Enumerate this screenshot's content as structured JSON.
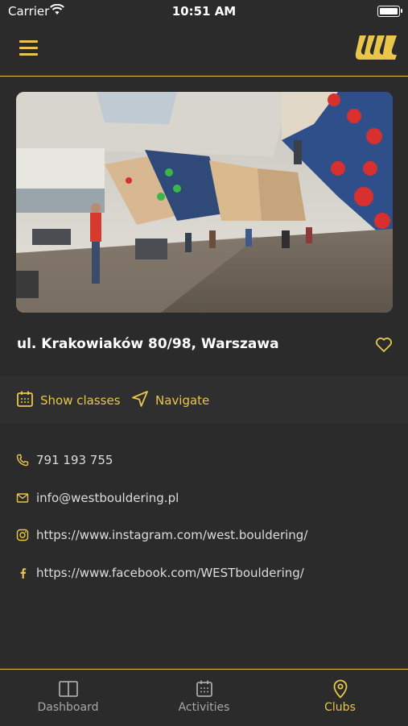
{
  "status_bar": {
    "carrier": "Carrier",
    "time": "10:51 AM"
  },
  "header": {
    "menu_icon": "hamburger-menu-icon",
    "logo_icon": "west-bouldering-logo"
  },
  "club": {
    "address": "ul. Krakowiaków 80/98, Warszawa",
    "photo": "climbing-gym-photo"
  },
  "actions": {
    "show_classes": "Show classes",
    "navigate": "Navigate"
  },
  "contacts": [
    {
      "icon": "phone-icon",
      "value": "791 193 755"
    },
    {
      "icon": "mail-icon",
      "value": "info@westbouldering.pl"
    },
    {
      "icon": "instagram-icon",
      "value": "https://www.instagram.com/west.bouldering/"
    },
    {
      "icon": "facebook-icon",
      "value": "https://www.facebook.com/WESTbouldering/"
    }
  ],
  "tabs": [
    {
      "label": "Dashboard",
      "icon": "dashboard-icon",
      "active": false
    },
    {
      "label": "Activities",
      "icon": "calendar-icon",
      "active": false
    },
    {
      "label": "Clubs",
      "icon": "location-pin-icon",
      "active": true
    }
  ],
  "colors": {
    "accent": "#e9c64a",
    "background": "#2b2b2b",
    "text": "#ffffff"
  }
}
